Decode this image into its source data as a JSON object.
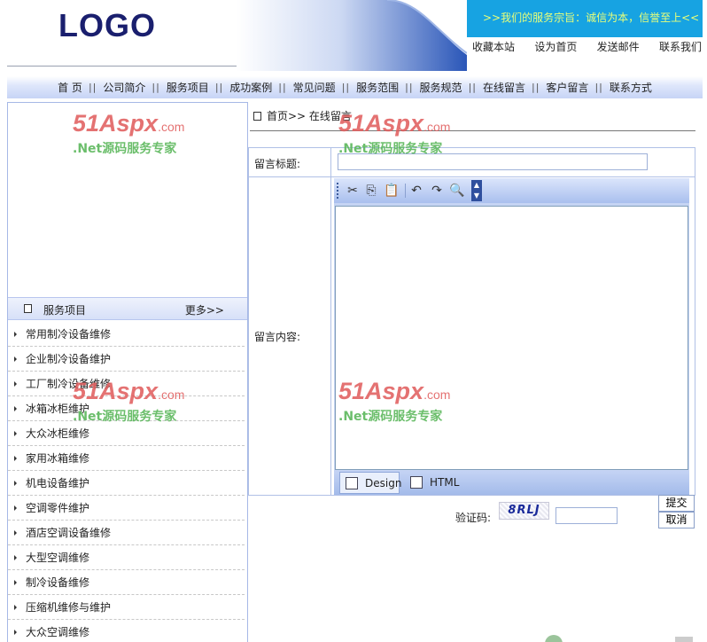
{
  "header": {
    "logo_text": "LOGO",
    "slogan": ">>我们的服务宗旨：诚信为本，信誉至上<<",
    "toplinks": [
      "收藏本站",
      "设为首页",
      "发送邮件",
      "联系我们"
    ]
  },
  "nav": [
    "首 页",
    "公司简介",
    "服务项目",
    "成功案例",
    "常见问题",
    "服务范围",
    "服务规范",
    "在线留言",
    "客户留言",
    "联系方式"
  ],
  "nav_separator": "||",
  "sidebar": {
    "section_title": "服务项目",
    "more_label": "更多>>",
    "items": [
      "常用制冷设备维修",
      "企业制冷设备维护",
      "工厂制冷设备维修",
      "冰箱冰柜维护",
      "大众冰柜维修",
      "家用冰箱维修",
      "机电设备维护",
      "空调零件维护",
      "酒店空调设备维修",
      "大型空调维修",
      "制冷设备维修",
      "压缩机维修与维护",
      "大众空调维修"
    ]
  },
  "breadcrumb": {
    "text": "首页>> 在线留言"
  },
  "form": {
    "title_label": "留言标题:",
    "title_value": "",
    "content_label": "留言内容:",
    "modes": [
      "Design",
      "HTML"
    ],
    "captcha_label": "验证码:",
    "captcha_text": "8RLJ",
    "captcha_value": "",
    "submit_label": "提交",
    "cancel_label": "取消"
  },
  "toolbar_icons": [
    "cut-icon",
    "copy-icon",
    "paste-icon",
    "undo-icon",
    "redo-icon",
    "preview-icon"
  ],
  "watermark": {
    "brand": "51Aspx",
    "domain": ".com",
    "tagline": ".Net源码服务专家"
  },
  "colors": {
    "slogan_bg": "#17a3e2",
    "slogan_text": "#e8ff7a",
    "logo": "#1a1f6e",
    "border": "#a6b8e6"
  }
}
